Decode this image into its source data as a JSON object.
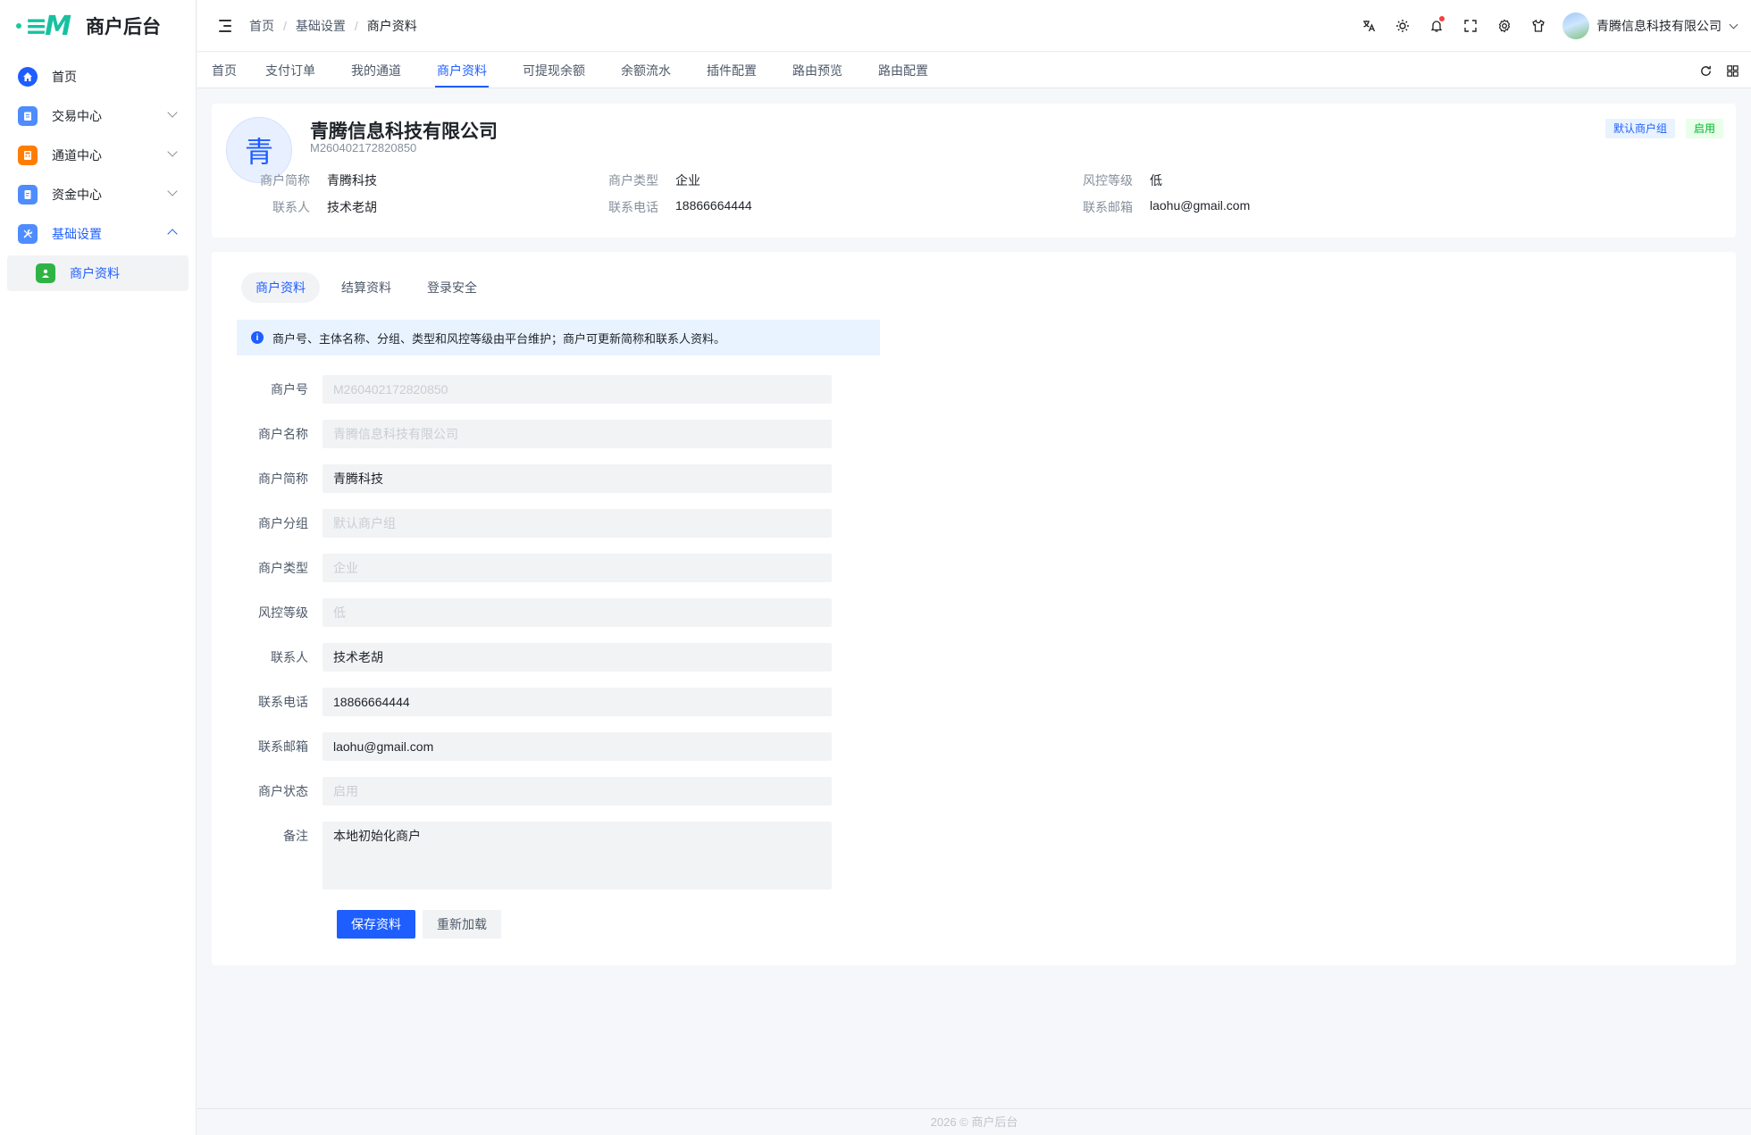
{
  "app": {
    "title": "商户后台",
    "accent": "#1e5eff"
  },
  "sidebar": {
    "items": [
      {
        "label": "首页",
        "icon": "home-icon",
        "color": "#1e5eff"
      },
      {
        "label": "交易中心",
        "icon": "clipboard-icon",
        "color": "#4e8cff"
      },
      {
        "label": "通道中心",
        "icon": "calculator-icon",
        "color": "#ff7d00"
      },
      {
        "label": "资金中心",
        "icon": "document-icon",
        "color": "#4e8cff"
      },
      {
        "label": "基础设置",
        "icon": "tools-icon",
        "color": "#4e8cff"
      }
    ],
    "sub_items": [
      {
        "label": "商户资料",
        "icon": "user-icon",
        "color": "#00b42a"
      }
    ]
  },
  "header": {
    "breadcrumb": [
      "首页",
      "基础设置",
      "商户资料"
    ],
    "user_name": "青腾信息科技有限公司"
  },
  "tabs": [
    "首页",
    "支付订单",
    "我的通道",
    "商户资料",
    "可提现余额",
    "余额流水",
    "插件配置",
    "路由预览",
    "路由配置"
  ],
  "profile": {
    "avatar_char": "青",
    "name": "青腾信息科技有限公司",
    "merchant_no": "M260402172820850",
    "badges": {
      "group": "默认商户组",
      "status": "启用"
    },
    "fields": [
      {
        "label": "商户简称",
        "value": "青腾科技"
      },
      {
        "label": "商户类型",
        "value": "企业"
      },
      {
        "label": "风控等级",
        "value": "低"
      },
      {
        "label": "联系人",
        "value": "技术老胡"
      },
      {
        "label": "联系电话",
        "value": "18866664444"
      },
      {
        "label": "联系邮箱",
        "value": "laohu@gmail.com"
      }
    ]
  },
  "form": {
    "tabs": [
      "商户资料",
      "结算资料",
      "登录安全"
    ],
    "notice": "商户号、主体名称、分组、类型和风控等级由平台维护；商户可更新简称和联系人资料。",
    "fields": [
      {
        "label": "商户号",
        "value": "M260402172820850",
        "disabled": true
      },
      {
        "label": "商户名称",
        "value": "青腾信息科技有限公司",
        "disabled": true
      },
      {
        "label": "商户简称",
        "value": "青腾科技",
        "disabled": false
      },
      {
        "label": "商户分组",
        "value": "默认商户组",
        "disabled": true
      },
      {
        "label": "商户类型",
        "value": "企业",
        "disabled": true
      },
      {
        "label": "风控等级",
        "value": "低",
        "disabled": true
      },
      {
        "label": "联系人",
        "value": "技术老胡",
        "disabled": false
      },
      {
        "label": "联系电话",
        "value": "18866664444",
        "disabled": false
      },
      {
        "label": "联系邮箱",
        "value": "laohu@gmail.com",
        "disabled": false
      },
      {
        "label": "商户状态",
        "value": "启用",
        "disabled": true
      }
    ],
    "remark": {
      "label": "备注",
      "value": "本地初始化商户"
    },
    "save_label": "保存资料",
    "reload_label": "重新加载"
  },
  "footer": "2026 © 商户后台"
}
